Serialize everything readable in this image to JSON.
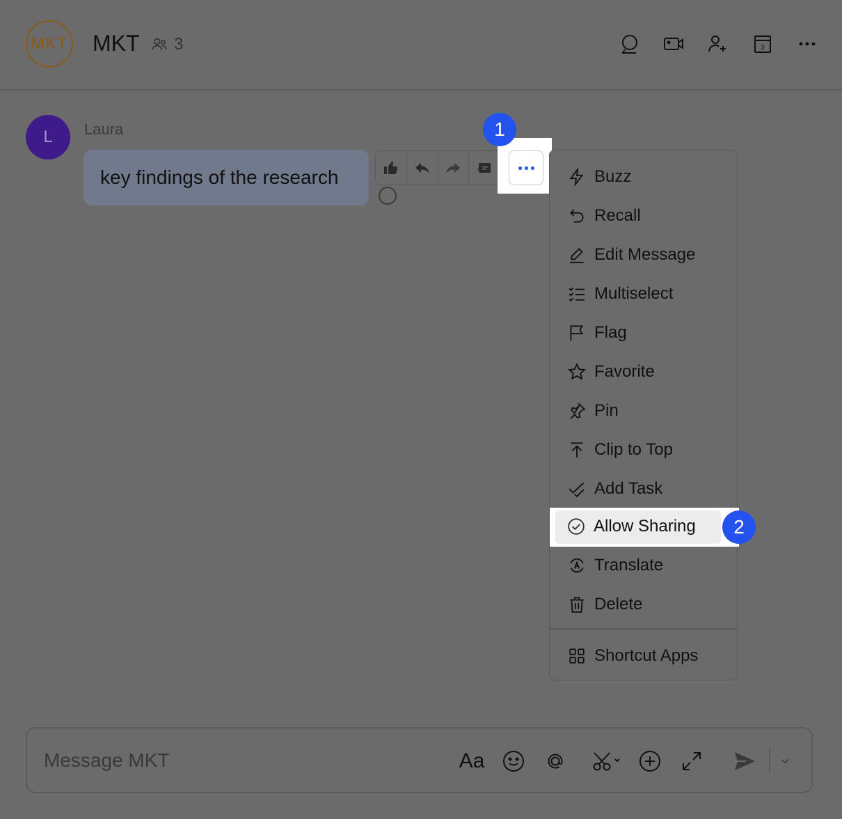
{
  "header": {
    "avatar_text": "MKT",
    "title": "MKT",
    "member_count": "3",
    "icons": [
      "search-chat-icon",
      "video-call-icon",
      "add-member-icon",
      "calendar-icon",
      "more-icon"
    ]
  },
  "message": {
    "sender_initial": "L",
    "sender_name": "Laura",
    "text": "key findings of the research"
  },
  "toolbar": {
    "icons": [
      "thumbs-up-icon",
      "reply-icon",
      "forward-icon",
      "thread-icon",
      "more-dots-icon"
    ]
  },
  "badges": {
    "step1": "1",
    "step2": "2"
  },
  "menu": {
    "items": [
      {
        "label": "Buzz",
        "icon": "lightning-icon"
      },
      {
        "label": "Recall",
        "icon": "undo-icon"
      },
      {
        "label": "Edit Message",
        "icon": "pencil-icon"
      },
      {
        "label": "Multiselect",
        "icon": "checklist-icon"
      },
      {
        "label": "Flag",
        "icon": "flag-icon"
      },
      {
        "label": "Favorite",
        "icon": "star-icon"
      },
      {
        "label": "Pin",
        "icon": "pin-icon"
      },
      {
        "label": "Clip to Top",
        "icon": "arrow-to-top-icon"
      },
      {
        "label": "Add Task",
        "icon": "task-icon"
      },
      {
        "label": "Allow Sharing",
        "icon": "check-circle-icon"
      },
      {
        "label": "Translate",
        "icon": "translate-icon"
      },
      {
        "label": "Delete",
        "icon": "trash-icon"
      },
      {
        "label": "Shortcut Apps",
        "icon": "grid-icon"
      }
    ],
    "highlighted": "Allow Sharing"
  },
  "composer": {
    "placeholder": "Message MKT",
    "format_label": "Aa"
  },
  "colors": {
    "accent": "#2452ee",
    "overlay": "#6b6b6b"
  }
}
